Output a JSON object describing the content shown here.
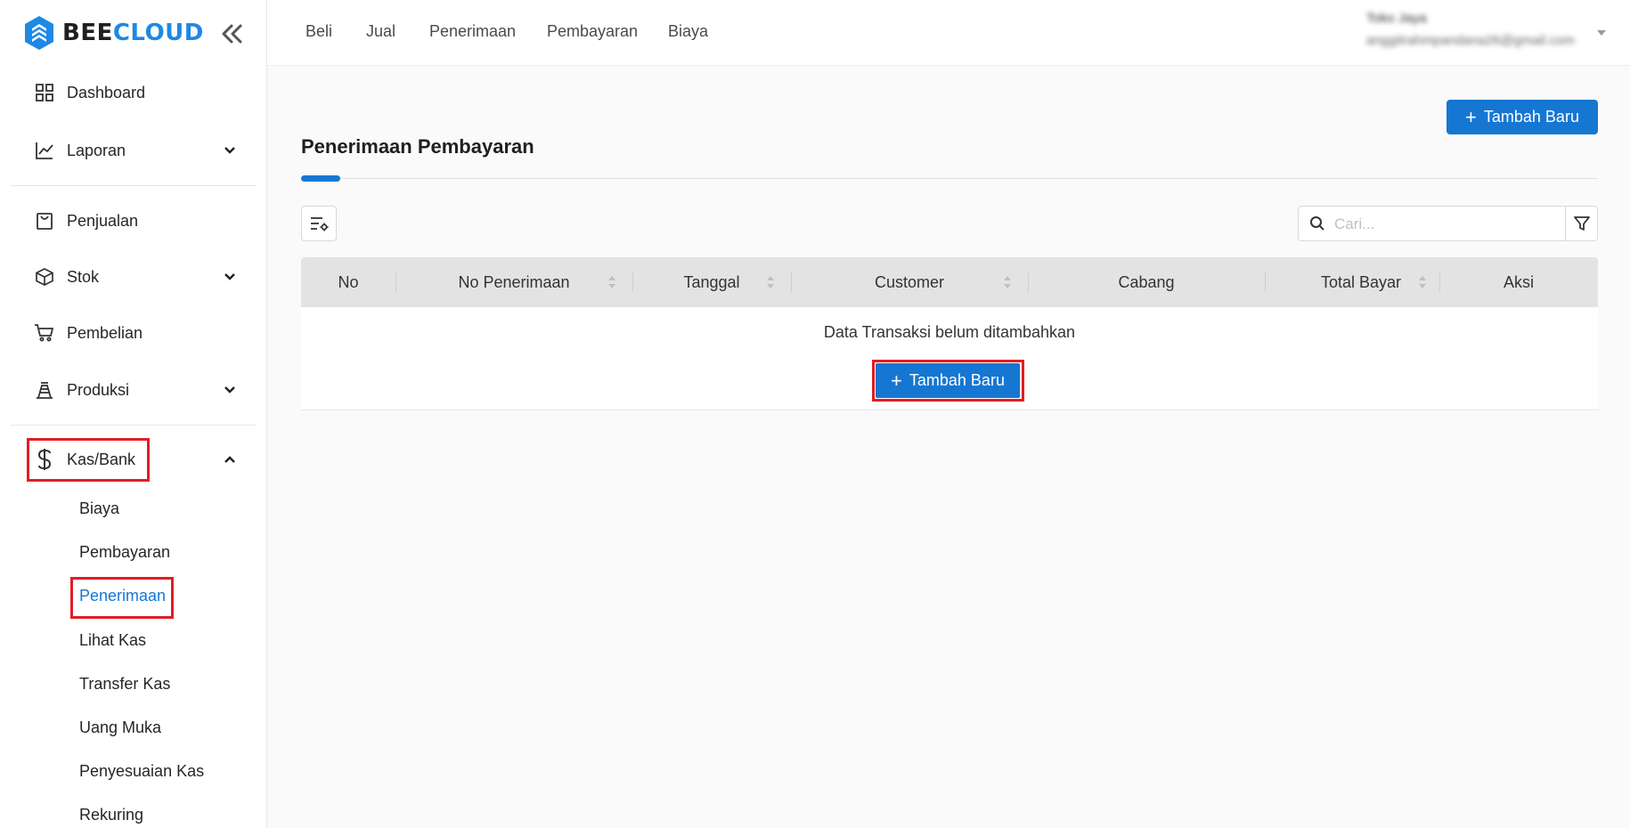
{
  "brand": {
    "part1": "BEE",
    "part2": "CLOUD"
  },
  "sidebar": {
    "items": [
      {
        "label": "Dashboard",
        "icon": "grid-icon"
      },
      {
        "label": "Laporan",
        "icon": "chart-line-icon"
      },
      {
        "label": "Penjualan",
        "icon": "shopping-bag-icon"
      },
      {
        "label": "Stok",
        "icon": "box-icon"
      },
      {
        "label": "Pembelian",
        "icon": "cart-icon"
      },
      {
        "label": "Produksi",
        "icon": "factory-icon"
      },
      {
        "label": "Kas/Bank",
        "icon": "dollar-icon"
      }
    ],
    "submenu": [
      "Biaya",
      "Pembayaran",
      "Penerimaan",
      "Lihat Kas",
      "Transfer Kas",
      "Uang Muka",
      "Penyesuaian Kas",
      "Rekuring"
    ]
  },
  "topnav": [
    "Beli",
    "Jual",
    "Penerimaan",
    "Pembayaran",
    "Biaya"
  ],
  "user": {
    "name": "Toko Jaya",
    "email": "anggitrahmpandana26@gmail.com"
  },
  "page": {
    "title": "Penerimaan Pembayaran",
    "add_button": "Tambah Baru"
  },
  "search": {
    "placeholder": "Cari..."
  },
  "table": {
    "columns": [
      "No",
      "No Penerimaan",
      "Tanggal",
      "Customer",
      "Cabang",
      "Total Bayar",
      "Aksi"
    ],
    "empty_text": "Data Transaksi belum ditambahkan",
    "empty_button": "Tambah Baru"
  },
  "colors": {
    "accent": "#1677d2",
    "highlight": "#e01e25"
  }
}
